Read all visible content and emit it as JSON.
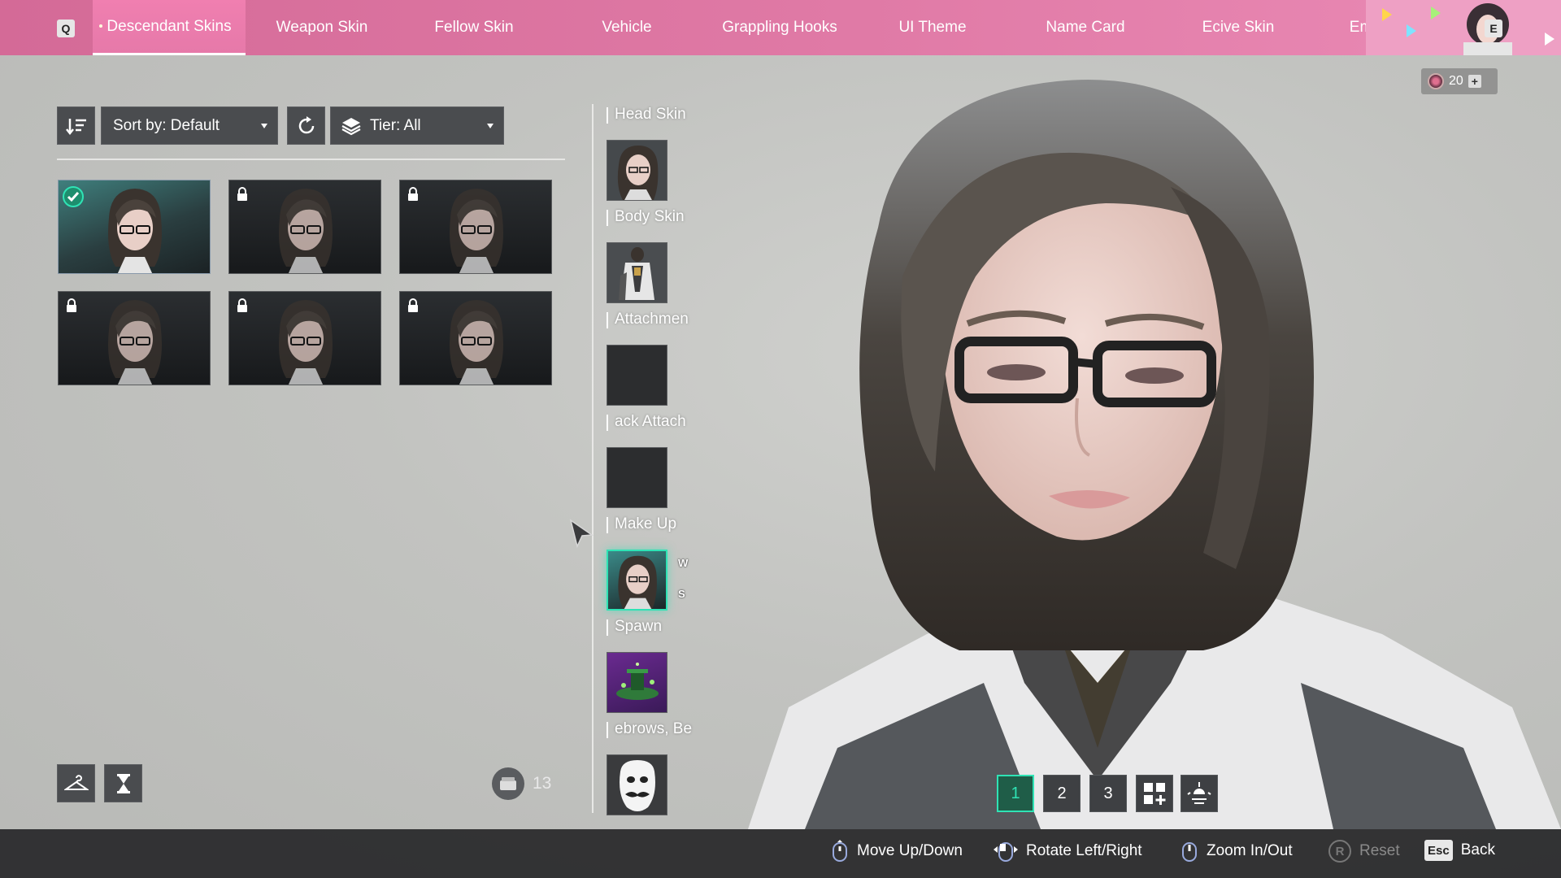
{
  "topbar": {
    "left_key": "Q",
    "right_key": "E",
    "tabs": [
      {
        "label": "Descendant Skins",
        "active": true
      },
      {
        "label": "Weapon Skin",
        "active": false
      },
      {
        "label": "Fellow Skin",
        "active": false
      },
      {
        "label": "Vehicle",
        "active": false
      },
      {
        "label": "Grappling Hooks",
        "active": false
      },
      {
        "label": "UI Theme",
        "active": false
      },
      {
        "label": "Name Card",
        "active": false
      },
      {
        "label": "Ecive Skin",
        "active": false
      },
      {
        "label": "Emotes",
        "active": false
      }
    ]
  },
  "currency": {
    "amount": "20",
    "icon": "coin-icon"
  },
  "filters": {
    "sort_label": "Sort by: Default",
    "tier_label": "Tier: All"
  },
  "skins": [
    {
      "state": "selected"
    },
    {
      "state": "locked"
    },
    {
      "state": "locked"
    },
    {
      "state": "locked"
    },
    {
      "state": "locked"
    },
    {
      "state": "locked"
    }
  ],
  "storage": {
    "count": "13"
  },
  "slots": [
    {
      "label": "Head Skin",
      "thumb": "portrait"
    },
    {
      "label": "Body Skin",
      "thumb": "body"
    },
    {
      "label": "Attachmen",
      "thumb": "empty"
    },
    {
      "label": "ack Attach",
      "thumb": "empty"
    },
    {
      "label": "Make Up",
      "thumb": "portrait-active"
    },
    {
      "label": "Spawn",
      "thumb": "spawn"
    },
    {
      "label": "ebrows, Be",
      "thumb": "mask"
    }
  ],
  "makeup_keys": {
    "up": "W",
    "down": "S"
  },
  "presets": [
    "1",
    "2",
    "3"
  ],
  "hints": {
    "move": "Move Up/Down",
    "rotate": "Rotate Left/Right",
    "zoom": "Zoom In/Out",
    "reset_key": "R",
    "reset": "Reset",
    "back_key": "Esc",
    "back": "Back"
  },
  "colors": {
    "topbar": "#e07aa6",
    "accent": "#2fe3b5",
    "panel": "#4a4c4f"
  }
}
